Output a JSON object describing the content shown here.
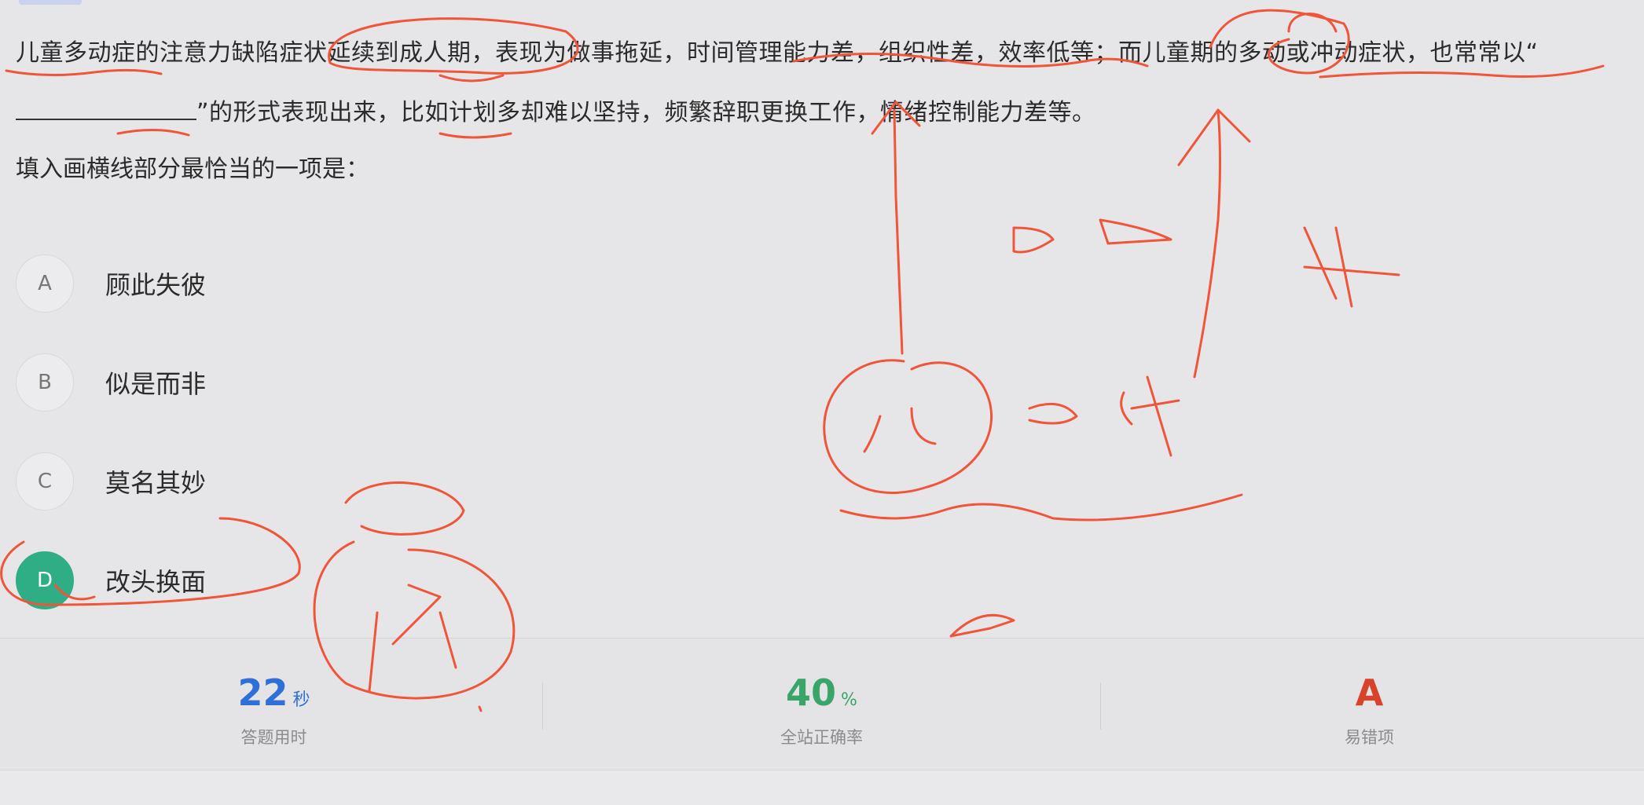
{
  "question": {
    "part1": "儿童多动症的注意力缺陷症状延续到成人期，表现为做事拖延，时间管理能力差，组织性差，效率低等；而儿童期的多动或冲动症状，也常常以“",
    "part2": "”的形式表现出来，比如计划多却难以坚持，频繁辞职更换工作，情绪控制能力差等。",
    "prompt": "填入画横线部分最恰当的一项是："
  },
  "options": [
    {
      "letter": "A",
      "text": "顾此失彼",
      "selected": false
    },
    {
      "letter": "B",
      "text": "似是而非",
      "selected": false
    },
    {
      "letter": "C",
      "text": "莫名其妙",
      "selected": false
    },
    {
      "letter": "D",
      "text": "改头换面",
      "selected": true
    }
  ],
  "stats": {
    "time": {
      "value": "22",
      "unit": "秒",
      "label": "答题用时",
      "color": "#2f6fd6"
    },
    "accuracy": {
      "value": "40",
      "unit": "%",
      "label": "全站正确率",
      "color": "#3aa568"
    },
    "common_wrong": {
      "value": "A",
      "label": "易错项",
      "color": "#d8432b"
    }
  },
  "colors": {
    "ink": "#f0553a",
    "selected": "#2fae86"
  }
}
